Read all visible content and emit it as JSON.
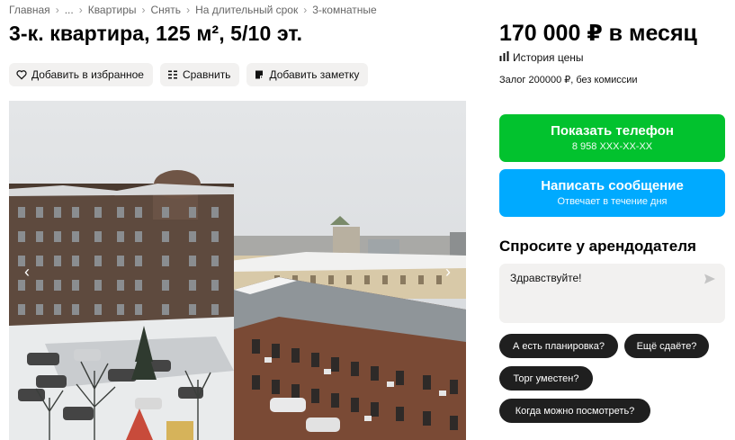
{
  "breadcrumb": [
    "Главная",
    "...",
    "Квартиры",
    "Снять",
    "На длительный срок",
    "3-комнатные"
  ],
  "listing": {
    "title": "3-к. квартира, 125 м², 5/10 эт."
  },
  "actions": {
    "favorite": {
      "label": "Добавить в избранное",
      "icon": "heart-icon"
    },
    "compare": {
      "label": "Сравнить",
      "icon": "compare-icon"
    },
    "note": {
      "label": "Добавить заметку",
      "icon": "note-icon"
    }
  },
  "gallery": {
    "prev_icon": "chevron-left-icon",
    "next_icon": "chevron-right-icon"
  },
  "pricing": {
    "price": "170 000 ₽ в месяц",
    "history_label": "История цены",
    "deposit": "Залог 200000 ₽, без комиссии"
  },
  "contact": {
    "phone_button": {
      "label": "Показать телефон",
      "sub": "8 958 XXX-XX-XX"
    },
    "message_button": {
      "label": "Написать сообщение",
      "sub": "Отвечает в течение дня"
    },
    "colors": {
      "phone": "#02c22e",
      "message": "#00aaff"
    }
  },
  "ask": {
    "title": "Спросите у арендодателя",
    "message_value": "Здравствуйте!",
    "quick_questions": [
      "А есть планировка?",
      "Ещё сдаёте?",
      "Торг уместен?",
      "Когда можно посмотреть?"
    ]
  }
}
